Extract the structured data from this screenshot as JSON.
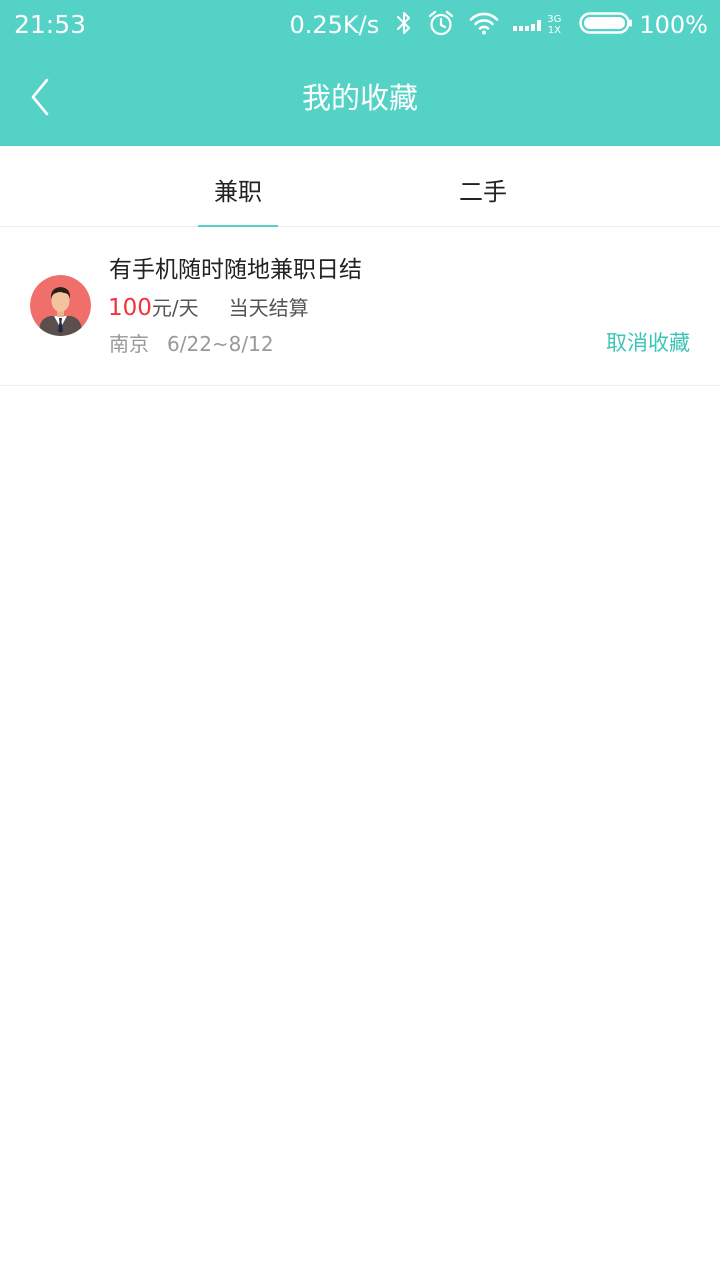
{
  "status_bar": {
    "time": "21:53",
    "net_speed": "0.25K/s",
    "network_top": "3G",
    "network_bottom": "1X",
    "battery": "100%"
  },
  "nav": {
    "title": "我的收藏",
    "back_icon": "chevron-left-icon"
  },
  "tabs": [
    {
      "label": "兼职",
      "active": true
    },
    {
      "label": "二手",
      "active": false
    }
  ],
  "favorites": [
    {
      "title": "有手机随时随地兼职日结",
      "pay_amount": "100",
      "pay_unit": "元/天",
      "settlement": "当天结算",
      "city": "南京",
      "date_range": "6/22~8/12",
      "action": "取消收藏"
    }
  ],
  "colors": {
    "header": "#55d2c6",
    "accent": "#3cc6b8",
    "price": "#f2333a"
  }
}
